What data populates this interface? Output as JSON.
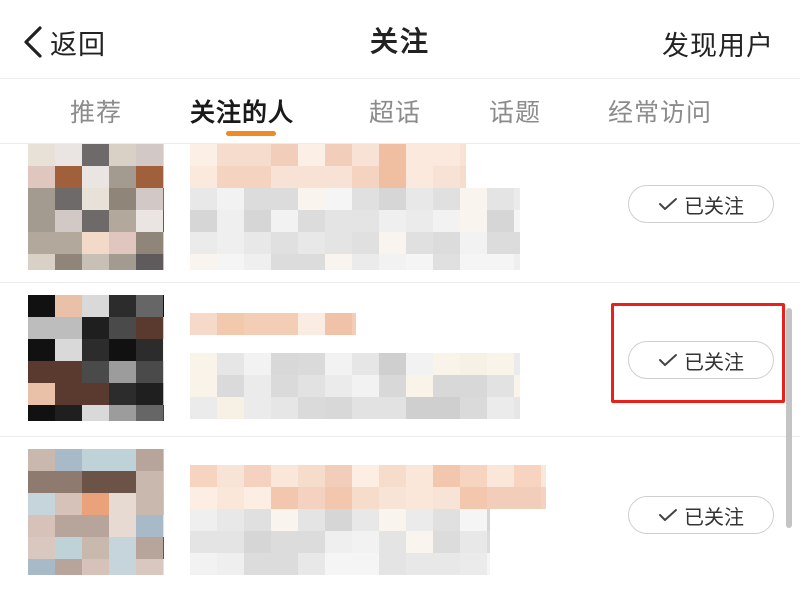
{
  "header": {
    "back_label": "返回",
    "title": "关注",
    "discover_label": "发现用户",
    "back_icon": "chevron-left-icon"
  },
  "tabs": [
    {
      "label": "推荐",
      "active": false
    },
    {
      "label": "关注的人",
      "active": true
    },
    {
      "label": "超话",
      "active": false
    },
    {
      "label": "话题",
      "active": false
    },
    {
      "label": "经常访问",
      "active": false
    }
  ],
  "follow_list": [
    {
      "follow_label": "已关注",
      "status_icon": "check-icon"
    },
    {
      "follow_label": "已关注",
      "status_icon": "check-icon",
      "highlighted": true
    },
    {
      "follow_label": "已关注",
      "status_icon": "check-icon"
    }
  ],
  "colors": {
    "accent": "#f08a24",
    "highlight": "#e8221b",
    "text_primary": "#222222",
    "text_secondary": "#8b8b8b",
    "divider": "#ececec"
  }
}
